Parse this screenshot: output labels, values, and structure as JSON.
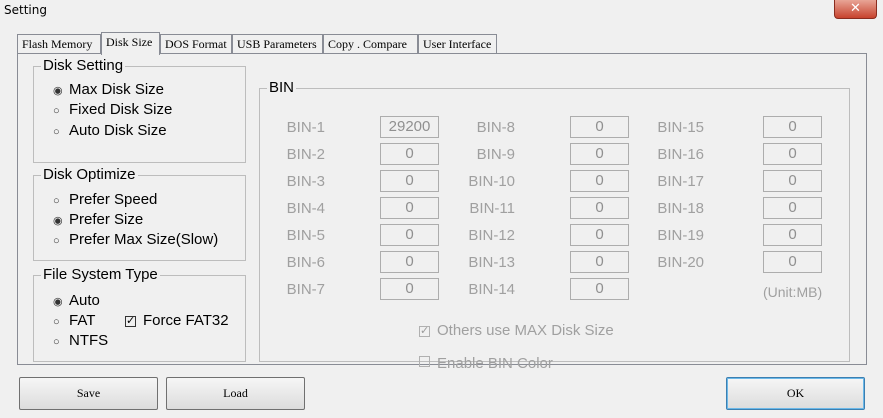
{
  "window": {
    "title": "Setting",
    "close_glyph": "✕"
  },
  "tabs": [
    {
      "label": "Flash Memory"
    },
    {
      "label": "Disk Size"
    },
    {
      "label": "DOS Format"
    },
    {
      "label": "USB Parameters"
    },
    {
      "label": "Copy . Compare"
    },
    {
      "label": "User Interface"
    }
  ],
  "active_tab": "Disk Size",
  "disk_setting": {
    "title": "Disk Setting",
    "options": [
      {
        "label": "Max Disk Size",
        "selected": true
      },
      {
        "label": "Fixed Disk Size",
        "selected": false
      },
      {
        "label": "Auto Disk Size",
        "selected": false
      }
    ]
  },
  "disk_optimize": {
    "title": "Disk Optimize",
    "options": [
      {
        "label": "Prefer Speed",
        "selected": false
      },
      {
        "label": "Prefer Size",
        "selected": true
      },
      {
        "label": "Prefer Max Size(Slow)",
        "selected": false
      }
    ]
  },
  "file_system": {
    "title": "File System Type",
    "options": [
      {
        "label": "Auto",
        "selected": true
      },
      {
        "label": "FAT",
        "selected": false
      },
      {
        "label": "NTFS",
        "selected": false
      }
    ],
    "force_fat32": {
      "label": "Force FAT32",
      "checked": true
    }
  },
  "bin": {
    "title": "BIN",
    "labels": [
      "BIN-1",
      "BIN-2",
      "BIN-3",
      "BIN-4",
      "BIN-5",
      "BIN-6",
      "BIN-7",
      "BIN-8",
      "BIN-9",
      "BIN-10",
      "BIN-11",
      "BIN-12",
      "BIN-13",
      "BIN-14",
      "BIN-15",
      "BIN-16",
      "BIN-17",
      "BIN-18",
      "BIN-19",
      "BIN-20"
    ],
    "values": [
      "29200",
      "0",
      "0",
      "0",
      "0",
      "0",
      "0",
      "0",
      "0",
      "0",
      "0",
      "0",
      "0",
      "0",
      "0",
      "0",
      "0",
      "0",
      "0",
      "0"
    ],
    "unit": "(Unit:MB)",
    "others_max": {
      "label": "Others use MAX Disk Size",
      "checked": true,
      "enabled": false
    },
    "bin_color": {
      "label": "Enable BIN Color",
      "checked": false,
      "enabled": false
    }
  },
  "buttons": {
    "save": "Save",
    "load": "Load",
    "ok": "OK"
  },
  "glyphs": {
    "radio_on": "◉",
    "radio_off": "○",
    "check_on": "✓"
  }
}
